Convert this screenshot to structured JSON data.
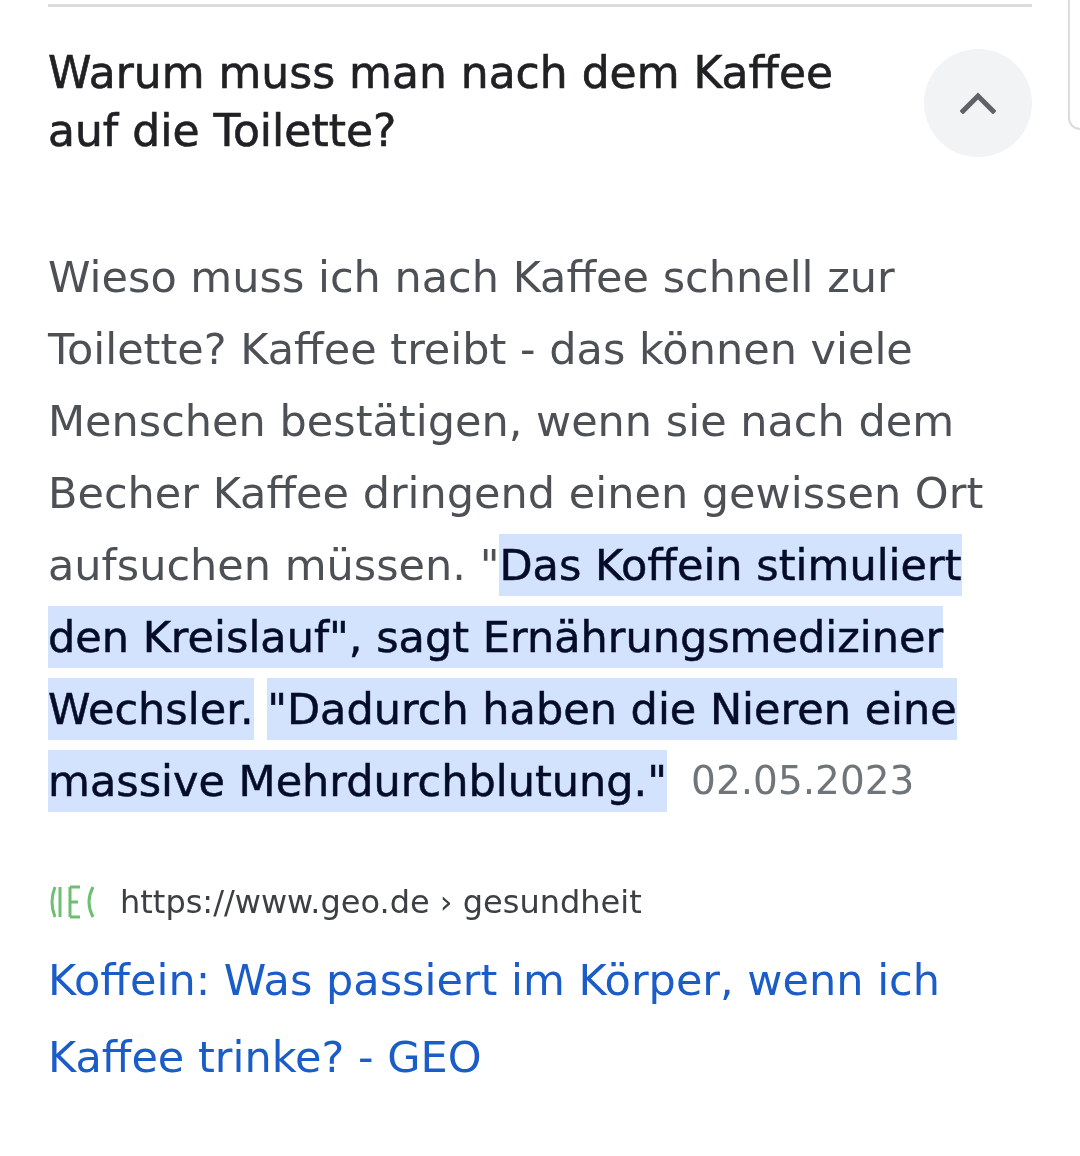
{
  "question": {
    "title": "Warum muss man nach dem Kaffee auf die Toilette?",
    "expanded": true
  },
  "answer": {
    "snippet": "Wieso muss ich nach Kaffee schnell zur Toilette? Kaffee treibt - das können viele Menschen bestätigen, wenn sie nach dem Becher Kaffee dringend einen gewissen Ort aufsuchen müssen. \"**Das Koffein stimuliert den Kreislauf\", sagt Ernährungsmediziner Wechsler.** **\"Dadurch haben die Nieren eine massive Mehrdurchblutung.\"**",
    "date": "02.05.2023"
  },
  "source": {
    "url": "https://www.geo.de › gesundheit",
    "title": "Koffein: Was passiert im Körper, wenn ich Kaffee trinke? - GEO"
  }
}
